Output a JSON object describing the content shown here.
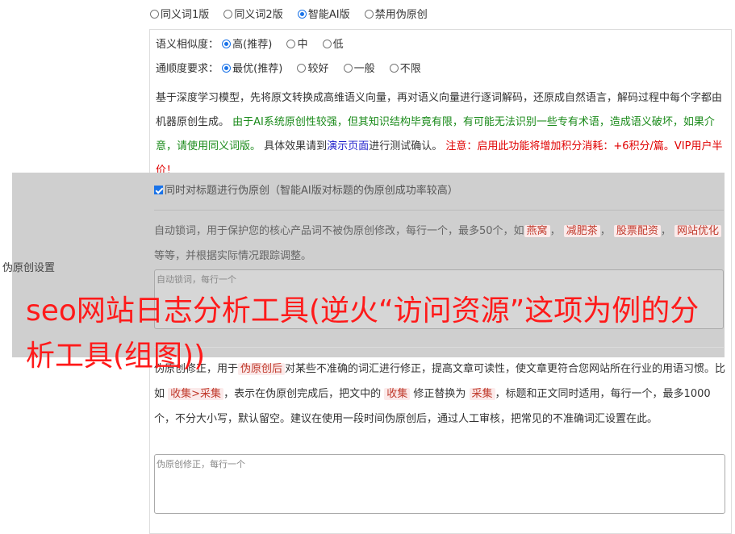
{
  "mode_options": [
    "同义词1版",
    "同义词2版",
    "智能AI版",
    "禁用伪原创"
  ],
  "mode_selected": "智能AI版",
  "similarity": {
    "label": "语义相似度：",
    "options": [
      "高(推荐)",
      "中",
      "低"
    ],
    "selected": "高(推荐)"
  },
  "fluency": {
    "label": "通顺度要求：",
    "options": [
      "最优(推荐)",
      "较好",
      "一般",
      "不限"
    ],
    "selected": "最优(推荐)"
  },
  "description": {
    "part1": "基于深度学习模型，先将原文转换成高维语义向量，再对语义向量进行逐词解码，还原成自然语言，解码过程中每个字都由机器原创生成。",
    "part2_green": "由于AI系统原创性较强，但其知识结构毕竟有限，有可能无法识别一些专有术语，造成语义破坏，如果介意，请使用同义词版。",
    "part3": "具体效果请到",
    "link": "演示页面",
    "part4": "进行测试确认。",
    "part5_red": "注意：启用此功能将增加积分消耗：+6积分/篇。VIP用户半价！"
  },
  "title_checkbox": {
    "label": "同时对标题进行伪原创（智能AI版对标题的伪原创成功率较高）",
    "checked": true
  },
  "lock": {
    "desc_before": "自动锁词，用于保护您的核心产品词不被伪原创修改，每行一个，最多50个，如",
    "examples": [
      "燕窝",
      "减肥茶",
      "股票配资",
      "网站优化"
    ],
    "desc_after": "等等，并根据实际情况跟踪调整。",
    "placeholder": "自动锁词，每行一个"
  },
  "sidebar_label": "伪原创设置",
  "fix": {
    "desc1": "伪原创修正，用于",
    "chip1": "伪原创后",
    "desc2": "对某些不准确的词汇进行修正，提高文章可读性，使文章更符合您网站所在行业的用语习惯。比如",
    "chip2": "收集>采集",
    "desc3": "，表示在伪原创完成后，把文中的",
    "chip3": "收集",
    "desc4": "修正替换为",
    "chip4": "采集",
    "desc5": "，标题和正文同时适用，每行一个，最多1000个，不分大小写，默认留空。建议在使用一段时间伪原创后，通过人工审核，把常见的不准确词汇设置在此。",
    "placeholder": "伪原创修正，每行一个"
  },
  "overlay_title": "seo网站日志分析工具(逆火“访问资源”这项为例的分析工具(组图))"
}
